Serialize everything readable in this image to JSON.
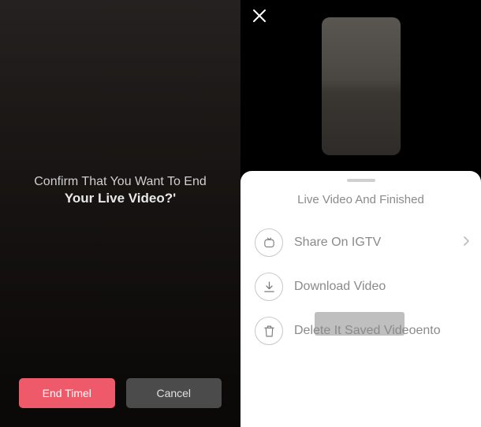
{
  "left": {
    "confirm_line1": "Confirm That You Want To End",
    "confirm_line2": "Your Live Video?'",
    "end_button": "End Timel",
    "cancel_button": "Cancel"
  },
  "right": {
    "sheet_title": "Live Video And Finished",
    "actions": {
      "share": "Share On IGTV",
      "download": "Download Video",
      "delete": "Delete It Saved Videoento"
    }
  },
  "colors": {
    "primary_red": "#ee5a6a",
    "muted_text": "#8a8a8a"
  }
}
